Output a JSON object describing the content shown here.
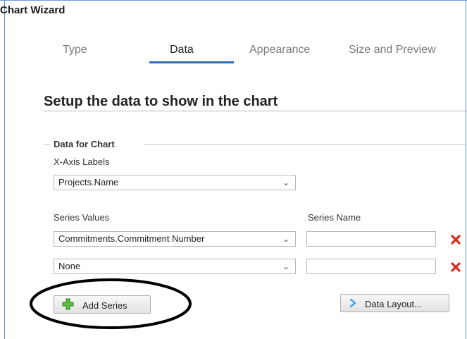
{
  "window": {
    "title": "Chart Wizard"
  },
  "tabs": [
    {
      "label": "Type",
      "active": false
    },
    {
      "label": "Data",
      "active": true
    },
    {
      "label": "Appearance",
      "active": false
    },
    {
      "label": "Size and Preview",
      "active": false
    }
  ],
  "section": {
    "title": "Setup the data to show in the chart"
  },
  "group": {
    "legend": "Data for Chart",
    "x_axis": {
      "label": "X-Axis Labels",
      "value": "Projects.Name"
    },
    "series_values_label": "Series Values",
    "series_name_label": "Series Name",
    "series": [
      {
        "value": "Commitments.Commitment Number",
        "name": ""
      },
      {
        "value": "None",
        "name": ""
      }
    ]
  },
  "buttons": {
    "add_series": "Add Series",
    "data_layout": "Data Layout..."
  },
  "colors": {
    "accent": "#2f6db5",
    "delete": "#d62b1f",
    "add": "#3f9f2f",
    "annotation": "#000000"
  },
  "icons": {
    "select_arrow": "chevron-down-icon",
    "delete": "red-x-icon",
    "add": "green-plus-icon",
    "data_layout": "chevron-right-icon"
  }
}
